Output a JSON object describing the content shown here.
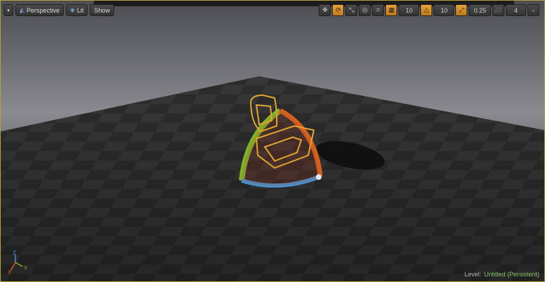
{
  "toolbar": {
    "perspective_label": "Perspective",
    "lit_label": "Lit",
    "show_label": "Show",
    "grid_snap_value": "10",
    "rotation_snap_value": "10",
    "scale_snap_value": "0.25",
    "camera_speed_value": "4"
  },
  "status": {
    "level_label": "Level:",
    "level_name": "Untitled (Persistent)"
  },
  "axis": {
    "x": "X",
    "y": "Y",
    "z": "Z"
  },
  "colors": {
    "selection": "#e3a52c",
    "gizmo_x": "#d5621f",
    "gizmo_y": "#80b12a",
    "gizmo_z": "#4a8fc7",
    "border": "#b8a13a"
  }
}
